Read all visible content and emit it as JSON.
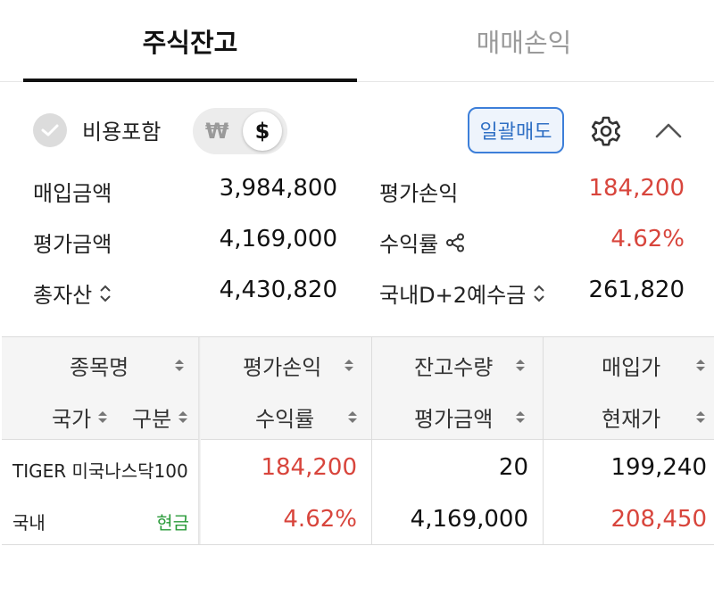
{
  "tabs": [
    {
      "label": "주식잔고",
      "active": true
    },
    {
      "label": "매매손익",
      "active": false
    }
  ],
  "summary": {
    "include_cost_label": "비용포함",
    "currency_toggle": {
      "won": "₩",
      "dollar": "$",
      "selected": "dollar"
    },
    "bulk_sell_label": "일괄매도",
    "rows": [
      {
        "left_label": "매입금액",
        "left_value": "3,984,800",
        "right_label": "평가손익",
        "right_value": "184,200"
      },
      {
        "left_label": "평가금액",
        "left_value": "4,169,000",
        "right_label": "수익률",
        "right_value": "4.62%"
      },
      {
        "left_label": "총자산",
        "left_value": "4,430,820",
        "right_label": "국내D+2예수금",
        "right_value": "261,820"
      }
    ]
  },
  "table": {
    "headers_row1": [
      "종목명",
      "평가손익",
      "잔고수량",
      "매입가"
    ],
    "headers_row2": [
      "국가",
      "구분",
      "수익률",
      "평가금액",
      "현재가"
    ],
    "rows": [
      {
        "name": "TIGER 미국나스닥100",
        "country": "국내",
        "type": "현금",
        "profit": "184,200",
        "rate": "4.62%",
        "quantity": "20",
        "eval_amount": "4,169,000",
        "buy_price": "199,240",
        "current_price": "208,450"
      }
    ]
  },
  "colors": {
    "profit_red": "#d8453c",
    "accent_blue": "#2f6fc4",
    "type_green": "#2a9b3a"
  }
}
